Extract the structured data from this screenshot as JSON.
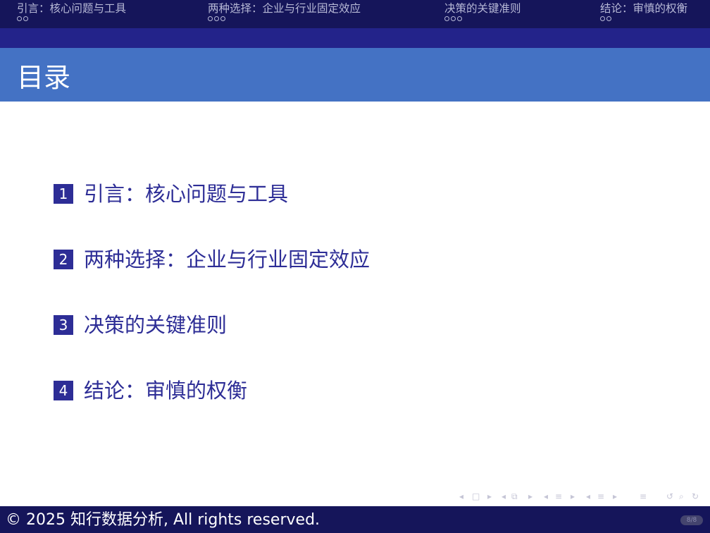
{
  "nav": {
    "sections": [
      {
        "label": "引言：核心问题与工具",
        "dots": 2
      },
      {
        "label": "两种选择：企业与行业固定效应",
        "dots": 3
      },
      {
        "label": "决策的关键准则",
        "dots": 3
      },
      {
        "label": "结论：审慎的权衡",
        "dots": 2
      }
    ]
  },
  "frame": {
    "title": "目录"
  },
  "toc": {
    "items": [
      {
        "number": "1",
        "label": "引言：核心问题与工具"
      },
      {
        "number": "2",
        "label": "两种选择：企业与行业固定效应"
      },
      {
        "number": "3",
        "label": "决策的关键准则"
      },
      {
        "number": "4",
        "label": "结论：审慎的权衡"
      }
    ]
  },
  "footer": {
    "copyright": "© 2025 知行数据分析, All rights reserved.",
    "page": "8/8"
  },
  "colors": {
    "nav_bg": "#15155a",
    "title_bg": "#4472c4",
    "accent": "#2d2d96"
  }
}
